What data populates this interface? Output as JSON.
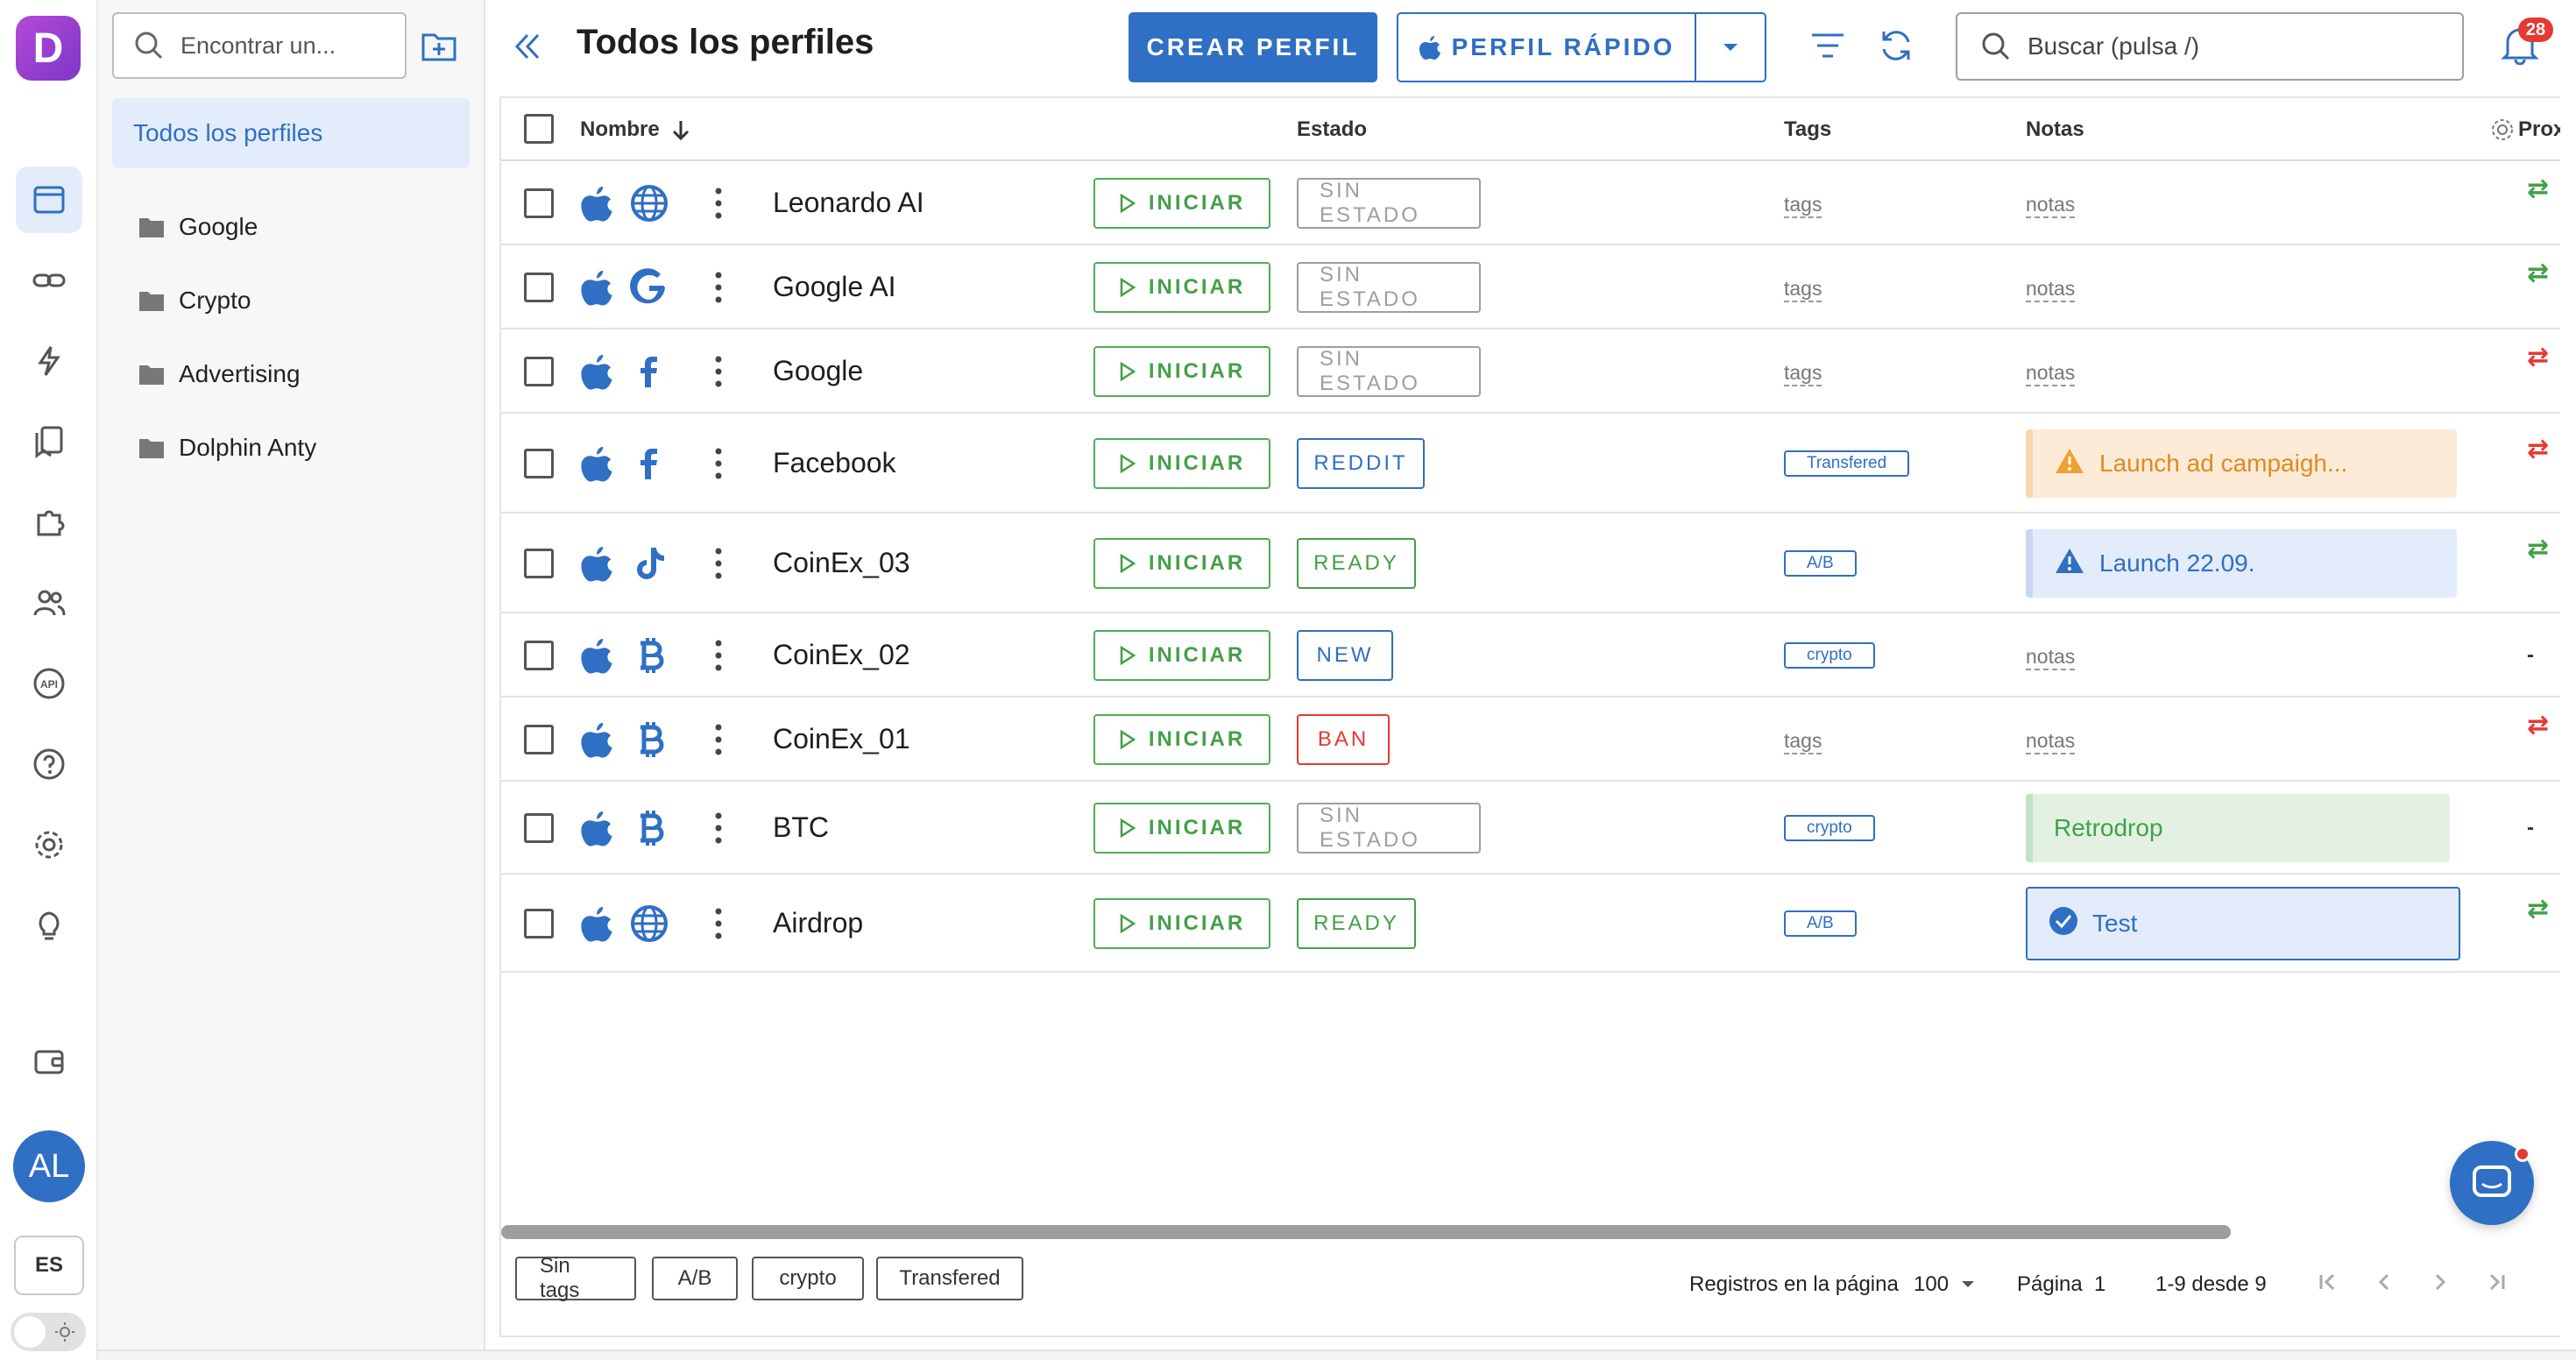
{
  "app": {
    "logo_letter": "D"
  },
  "sidebar": {
    "active_index": 0,
    "icons": [
      "browser-icon",
      "link-icon",
      "automation-icon",
      "bookmarks-icon",
      "extensions-icon",
      "team-icon",
      "api-icon",
      "help-icon",
      "settings-icon",
      "idea-icon",
      "wallet-icon"
    ],
    "avatar": "AL",
    "language": "ES"
  },
  "folders": {
    "search_placeholder": "Encontrar un...",
    "all_label": "Todos los perfiles",
    "items": [
      {
        "label": "Google"
      },
      {
        "label": "Crypto"
      },
      {
        "label": "Advertising"
      },
      {
        "label": "Dolphin Anty"
      }
    ]
  },
  "header": {
    "title": "Todos los perfiles",
    "create_label": "CREAR PERFIL",
    "quick_label": "PERFIL RÁPIDO",
    "search_placeholder": "Buscar (pulsa /)",
    "notifications": "28"
  },
  "table": {
    "columns": {
      "name": "Nombre",
      "status": "Estado",
      "tags": "Tags",
      "notes": "Notas",
      "proxy": "Prox"
    },
    "start_label": "INICIAR",
    "rows": [
      {
        "name": "Leonardo AI",
        "site_icon": "globe",
        "status": "SIN ESTADO",
        "status_color": "#9e9e9e",
        "tag": "tags",
        "tag_is_chip": false,
        "note": "notas",
        "note_style": "link",
        "proxy": "⇄",
        "proxy_color": "#43a047"
      },
      {
        "name": "Google AI",
        "site_icon": "google",
        "status": "SIN ESTADO",
        "status_color": "#9e9e9e",
        "tag": "tags",
        "tag_is_chip": false,
        "note": "notas",
        "note_style": "link",
        "proxy": "⇄",
        "proxy_color": "#43a047"
      },
      {
        "name": "Google",
        "site_icon": "facebook",
        "status": "SIN ESTADO",
        "status_color": "#9e9e9e",
        "tag": "tags",
        "tag_is_chip": false,
        "note": "notas",
        "note_style": "link",
        "proxy": "⇄",
        "proxy_color": "#e53935"
      },
      {
        "name": "Facebook",
        "site_icon": "facebook",
        "status": "REDDIT",
        "status_color": "#2f6fc4",
        "tag": "Transfered",
        "tag_is_chip": true,
        "note": "Launch ad campaigh...",
        "note_style": "warning",
        "proxy": "⇄",
        "proxy_color": "#e53935"
      },
      {
        "name": "CoinEx_03",
        "site_icon": "tiktok",
        "status": "READY",
        "status_color": "#43a047",
        "tag": "A/B",
        "tag_is_chip": true,
        "note": "Launch 22.09.",
        "note_style": "info",
        "proxy": "⇄",
        "proxy_color": "#43a047"
      },
      {
        "name": "CoinEx_02",
        "site_icon": "bitcoin",
        "status": "NEW",
        "status_color": "#2f6fc4",
        "tag": "crypto",
        "tag_is_chip": true,
        "note": "notas",
        "note_style": "link",
        "proxy": "-",
        "proxy_color": "#333333"
      },
      {
        "name": "CoinEx_01",
        "site_icon": "bitcoin",
        "status": "BAN",
        "status_color": "#e53935",
        "tag": "tags",
        "tag_is_chip": false,
        "note": "notas",
        "note_style": "link",
        "proxy": "⇄",
        "proxy_color": "#e53935"
      },
      {
        "name": "BTC",
        "site_icon": "bitcoin",
        "status": "SIN ESTADO",
        "status_color": "#9e9e9e",
        "tag": "crypto",
        "tag_is_chip": true,
        "note": "Retrodrop",
        "note_style": "success",
        "proxy": "-",
        "proxy_color": "#333333"
      },
      {
        "name": "Airdrop",
        "site_icon": "globe",
        "status": "READY",
        "status_color": "#43a047",
        "tag": "A/B",
        "tag_is_chip": true,
        "note": "Test",
        "note_style": "done",
        "proxy": "⇄",
        "proxy_color": "#43a047"
      }
    ]
  },
  "footer": {
    "tag_filters": [
      "Sin tags",
      "A/B",
      "crypto",
      "Transfered"
    ],
    "rows_per_page_label": "Registros en la página",
    "rows_per_page": "100",
    "page_label": "Página",
    "page": "1",
    "range": "1-9 desde 9"
  },
  "colors": {
    "accent": "#2f6fc4",
    "success": "#43a047",
    "danger": "#e53935",
    "warning_bg": "#fdebd8",
    "info_bg": "#e3ecfb",
    "success_bg": "#e2f1e2"
  }
}
